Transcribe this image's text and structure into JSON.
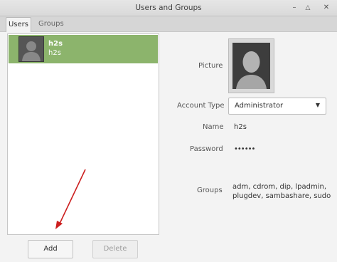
{
  "window": {
    "title": "Users and Groups"
  },
  "tabs": [
    {
      "label": "Users",
      "active": true
    },
    {
      "label": "Groups",
      "active": false
    }
  ],
  "users": [
    {
      "name": "h2s",
      "login": "h2s",
      "selected": true
    }
  ],
  "buttons": {
    "add": "Add",
    "delete": "Delete"
  },
  "details": {
    "picture_label": "Picture",
    "account_type_label": "Account Type",
    "account_type_value": "Administrator",
    "name_label": "Name",
    "name_value": "h2s",
    "password_label": "Password",
    "password_value": "••••••",
    "groups_label": "Groups",
    "groups_value": "adm, cdrom, dip, lpadmin, plugdev, sambashare, sudo"
  },
  "colors": {
    "selection": "#8cb46c",
    "annotation_arrow": "#cc1f1f"
  }
}
